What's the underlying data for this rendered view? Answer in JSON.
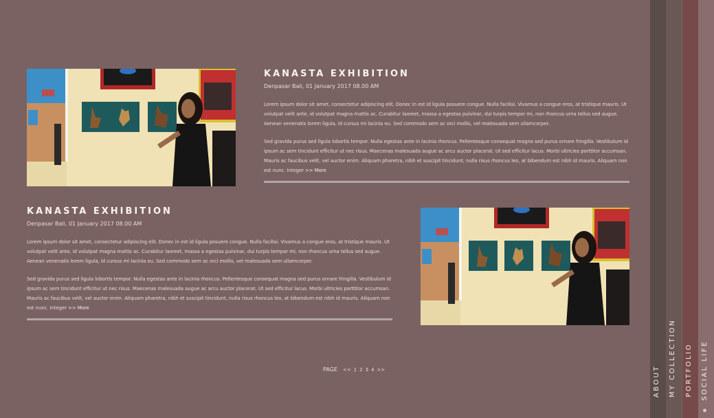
{
  "posts": [
    {
      "title": "KANASTA EXHIBITION",
      "meta": "Denpasar Bali, 01 January 2017   08.00 AM",
      "para1": "Lorem ipsum dolor sit amet, consectetur adipiscing elit. Donec in est id ligula posuere congue. Nulla facilisi. Vivamus a congue eros, at tristique mauris. Ut volutpat velit ante, id volutpat magna mattis ac. Curabitur laoreet, massa a egestas pulvinar, dui turpis tempor mi, non rhoncus urna tellus sed augue. Aenean venenatis lorem ligula, id cursus mi lacinia eu. Sed commodo sem ac orci mollis, vel malesuada sem ullamcorper.",
      "para2": "Sed gravida purus sed ligula lobortis tempor. Nulla egestas ante in lacinia rhoncus. Pellentesque consequat magna sed purus ornare fringilla. Vestibulum id ipsum ac sem tincidunt efficitur ut nec risus. Maecenas malesuada augue ac arcu auctor placerat. Ut sed efficitur lacus. Morbi ultricies porttitor accumsan. Mauris ac faucibus velit, vel auctor enim. Aliquam pharetra, nibh et suscipit tincidunt, nulla risus rhoncus leo, at bibendum est nibh id mauris. Aliquam non est nunc. Integer",
      "more": ">> More"
    },
    {
      "title": "KANASTA EXHIBITION",
      "meta": "Denpasar Bali, 01 January 2017   08.00 AM",
      "para1": "Lorem ipsum dolor sit amet, consectetur adipiscing elit. Donec in est id ligula posuere congue. Nulla facilisi. Vivamus a congue eros, at tristique mauris. Ut volutpat velit ante, id volutpat magna mattis ac. Curabitur laoreet, massa a egestas pulvinar, dui turpis tempor mi, non rhoncus urna tellus sed augue. Aenean venenatis lorem ligula, id cursus mi lacinia eu. Sed commodo sem ac orci mollis, vel malesuada sem ullamcorper.",
      "para2": "Sed gravida purus sed ligula lobortis tempor. Nulla egestas ante in lacinia rhoncus. Pellentesque consequat magna sed purus ornare fringilla. Vestibulum id ipsum ac sem tincidunt efficitur ut nec risus. Maecenas malesuada augue ac arcu auctor placerat. Ut sed efficitur lacus. Morbi ultricies porttitor accumsan. Mauris ac faucibus velit, vel auctor enim. Aliquam pharetra, nibh et suscipit tincidunt, nulla risus rhoncus leo, at bibendum est nibh id mauris. Aliquam non est nunc. Integer",
      "more": ">> More"
    }
  ],
  "pagination": {
    "label": "PAGE",
    "prev": "<<",
    "pages": [
      "1",
      "2",
      "3",
      "4"
    ],
    "next": ">>"
  },
  "nav": {
    "about": "ABOUT",
    "collection": "MY COLLECTION",
    "portfolio": "PORTFOLIO",
    "social": "SOCIAL LIFE"
  },
  "colors": {
    "background": "#7a6262",
    "strip_1": "#5a4c48",
    "strip_2": "#6a5854",
    "strip_3": "#764a4a",
    "strip_4": "#8a6e6e"
  }
}
